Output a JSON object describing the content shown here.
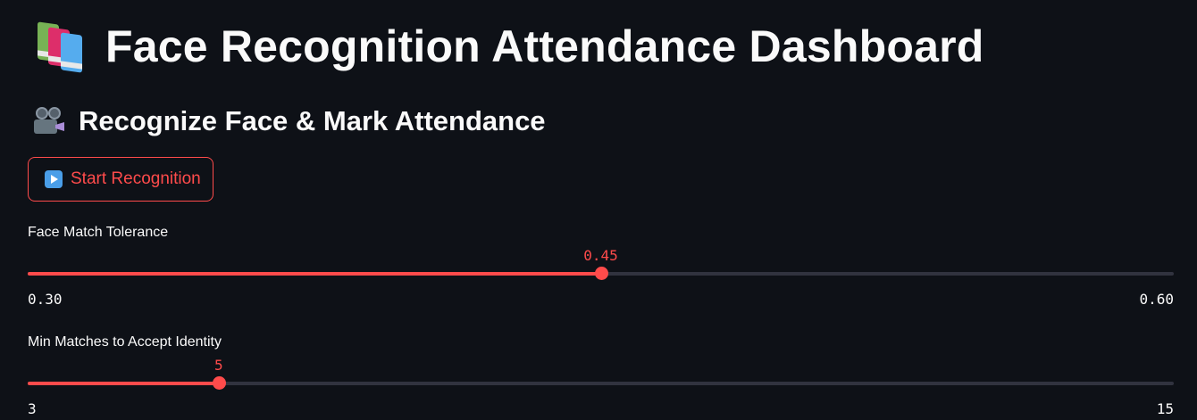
{
  "header": {
    "icon": "books-icon",
    "title": "Face Recognition Attendance Dashboard"
  },
  "section": {
    "icon": "movie-camera-icon",
    "subheader": "Recognize Face & Mark Attendance"
  },
  "start_button": {
    "icon": "play-button-icon",
    "label": "Start Recognition"
  },
  "sliders": [
    {
      "label": "Face Match Tolerance",
      "min": 0.3,
      "max": 0.6,
      "value": 0.45,
      "min_label": "0.30",
      "max_label": "0.60",
      "value_label": "0.45"
    },
    {
      "label": "Min Matches to Accept Identity",
      "min": 3,
      "max": 15,
      "value": 5,
      "min_label": "3",
      "max_label": "15",
      "value_label": "5"
    }
  ],
  "colors": {
    "background": "#0e1117",
    "accent": "#ff4b4b",
    "track": "#31333f",
    "text": "#fafafa"
  }
}
